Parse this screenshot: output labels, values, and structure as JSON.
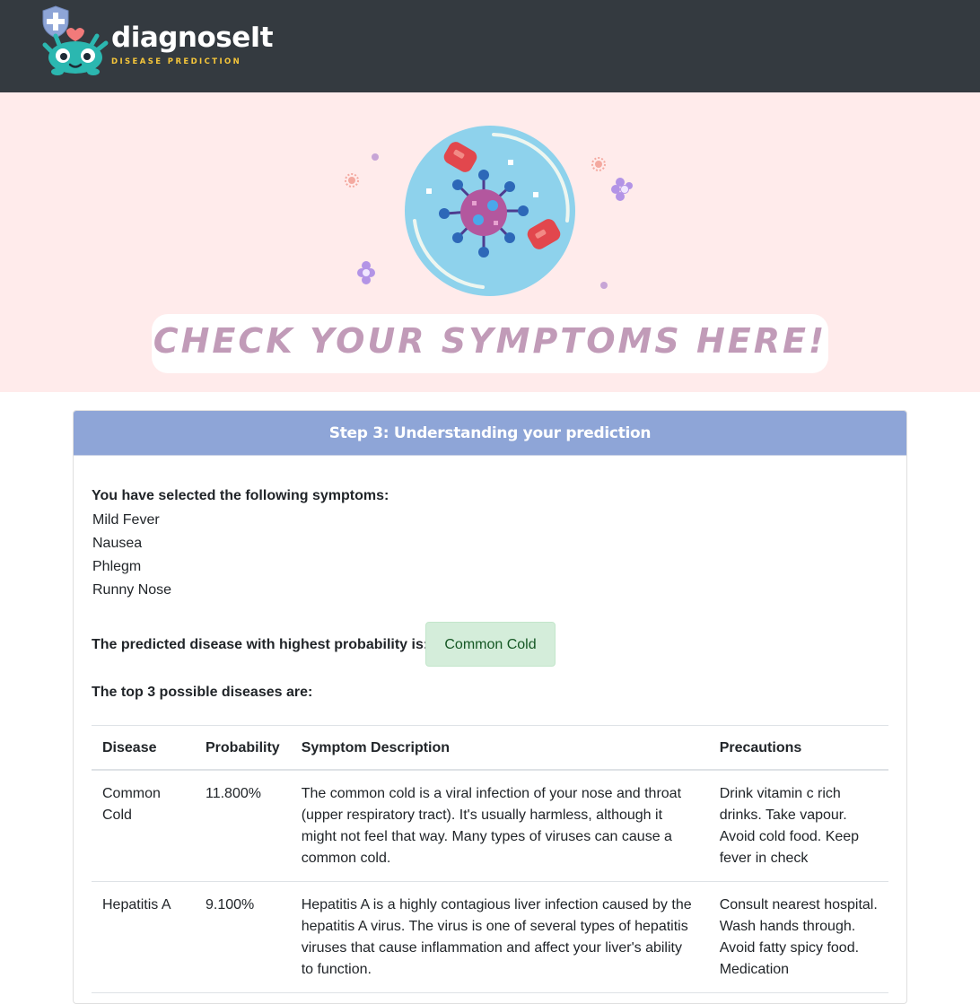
{
  "brand": {
    "name": "diagnoseIt",
    "tagline": "DISEASE PREDICTION"
  },
  "hero": {
    "banner_text": "CHECK YOUR SYMPTOMS HERE!"
  },
  "card": {
    "title": "Step 3: Understanding your prediction",
    "symptoms_heading": "You have selected the following symptoms:",
    "symptoms": [
      "Mild Fever",
      "Nausea",
      "Phlegm",
      "Runny Nose"
    ],
    "predicted_label": "The predicted disease with highest probability is:",
    "predicted_disease": "Common Cold",
    "top3_label": "The top 3 possible diseases are:"
  },
  "table": {
    "headers": [
      "Disease",
      "Probability",
      "Symptom Description",
      "Precautions"
    ],
    "rows": [
      {
        "disease": "Common Cold",
        "probability": "11.800%",
        "description": "The common cold is a viral infection of your nose and throat (upper respiratory tract). It's usually harmless, although it might not feel that way. Many types of viruses can cause a common cold.",
        "precautions": "Drink vitamin c rich drinks. Take vapour. Avoid cold food. Keep fever in check"
      },
      {
        "disease": "Hepatitis A",
        "probability": "9.100%",
        "description": "Hepatitis A is a highly contagious liver infection caused by the hepatitis A virus. The virus is one of several types of hepatitis viruses that cause inflammation and affect your liver's ability to function.",
        "precautions": "Consult nearest hospital. Wash hands through. Avoid fatty spicy food. Medication"
      }
    ]
  },
  "colors": {
    "navbar": "#343a40",
    "hero_bg": "#ffebeb",
    "card_header": "#8ea5d7",
    "badge_bg": "#d4edda",
    "banner_text": "#c19bb8"
  },
  "icons": [
    "mascot-logo-icon",
    "virus-illustration-icon"
  ]
}
